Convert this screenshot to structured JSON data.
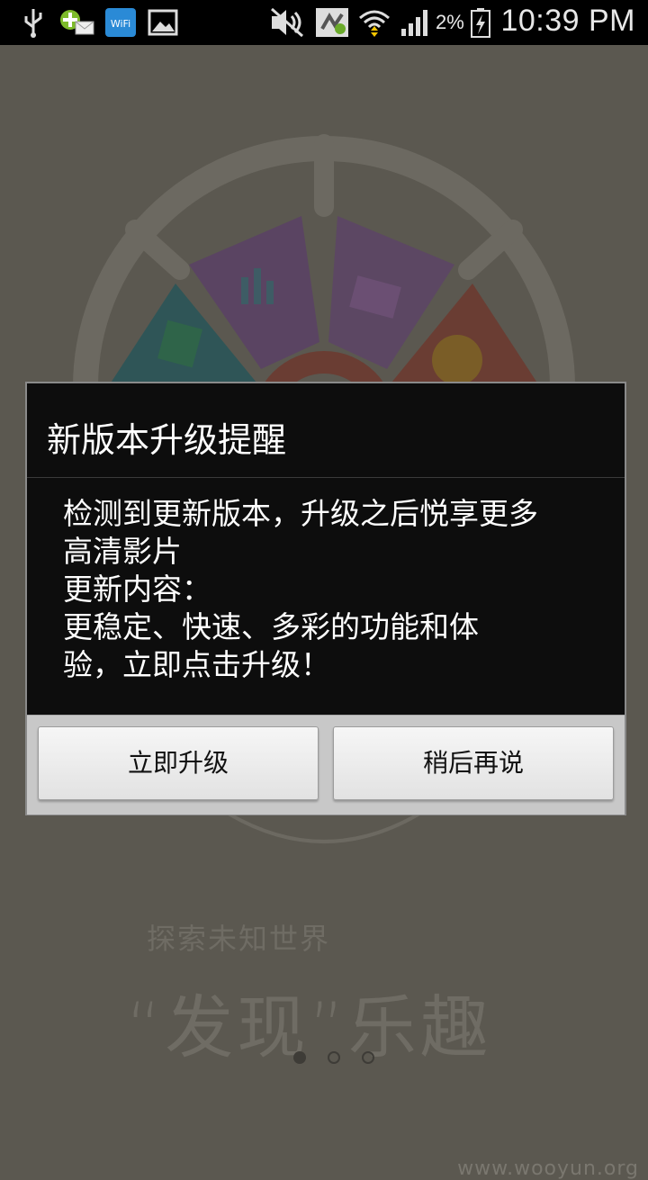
{
  "status_bar": {
    "time": "10:39 PM",
    "battery_percent": "2%",
    "icons": [
      "usb-icon",
      "message-notification-icon",
      "wifi-notification-icon",
      "gallery-icon",
      "mute-icon",
      "sync-icon",
      "wifi-signal-icon",
      "cell-signal-icon",
      "battery-charging-icon"
    ]
  },
  "splash": {
    "tagline_small": "探索未知世界",
    "tagline_big": "“发现”乐趣",
    "pager": {
      "count": 3,
      "active_index": 0
    }
  },
  "dialog": {
    "title": "新版本升级提醒",
    "message_lines": [
      "检测到更新版本，升级之后悦享更多",
      "高清影片",
      "更新内容：",
      "更稳定、快速、多彩的功能和体",
      "验，立即点击升级！"
    ],
    "buttons": {
      "upgrade": "立即升级",
      "later": "稍后再说"
    }
  },
  "watermark": "www.wooyun.org",
  "colors": {
    "overlay_background": "#5b5850",
    "dialog_background": "#0d0d0d",
    "wheel_purple": "#7c4b86",
    "wheel_teal": "#2f6b6c",
    "wheel_red": "#8a3a2c",
    "wheel_orange": "#8e6a22"
  }
}
